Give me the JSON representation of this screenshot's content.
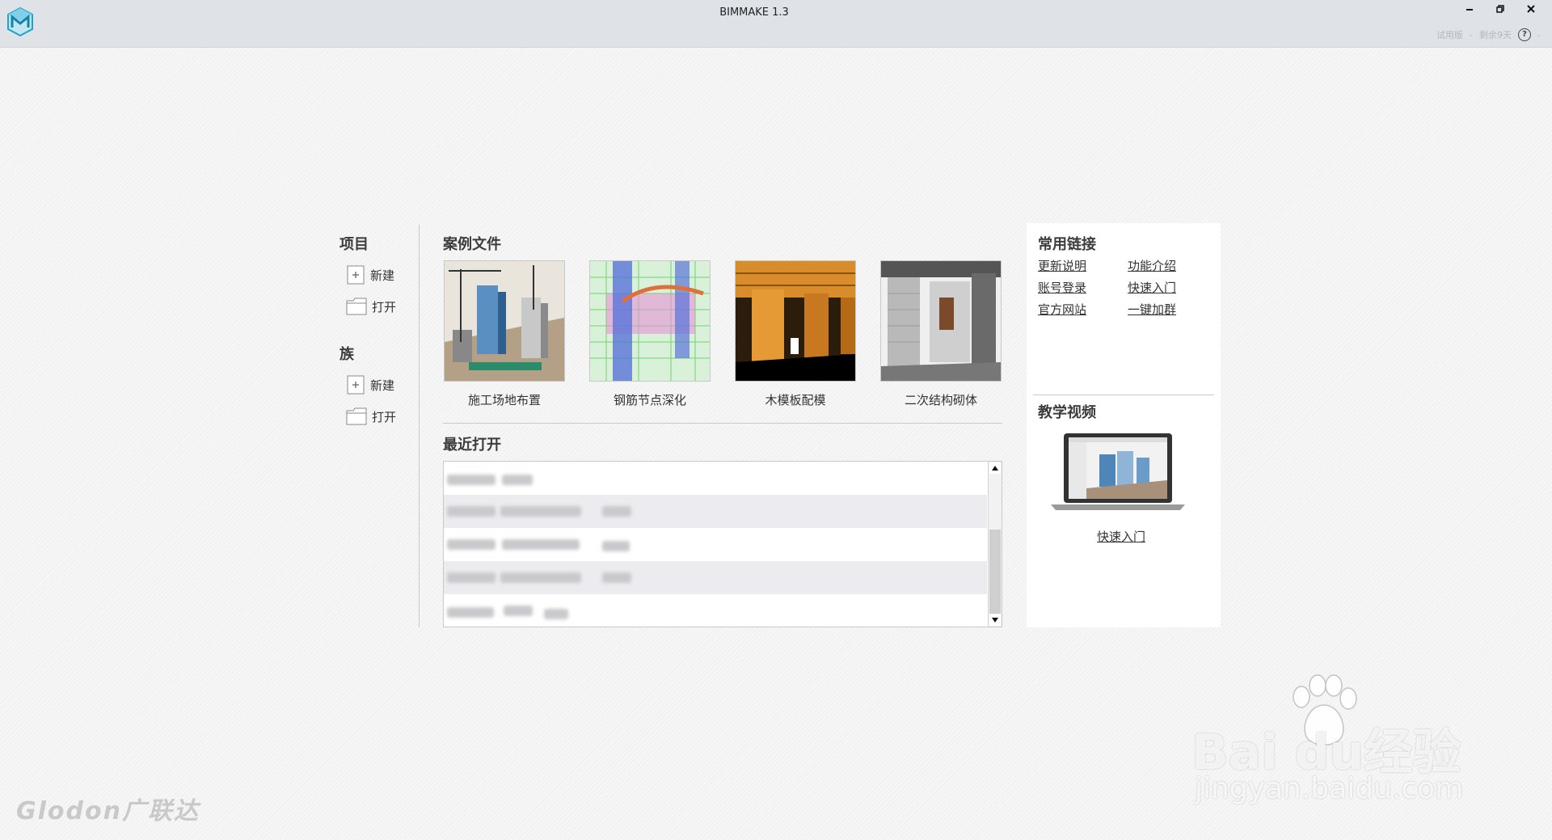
{
  "window": {
    "title": "BIMMAKE 1.3",
    "status_trial": "试用版",
    "status_remaining": "剩余9天",
    "help_symbol": "?"
  },
  "sidebar": {
    "project_title": "项目",
    "project_new": "新建",
    "project_open": "打开",
    "family_title": "族",
    "family_new": "新建",
    "family_open": "打开"
  },
  "cases": {
    "title": "案例文件",
    "items": [
      {
        "label": "施工场地布置"
      },
      {
        "label": "钢筋节点深化"
      },
      {
        "label": "木模板配模"
      },
      {
        "label": "二次结构砌体"
      }
    ]
  },
  "recent": {
    "title": "最近打开"
  },
  "links": {
    "title": "常用链接",
    "items": [
      "更新说明",
      "功能介绍",
      "账号登录",
      "快速入门",
      "官方网站",
      "一键加群"
    ]
  },
  "video": {
    "title": "教学视频",
    "link": "快速入门"
  },
  "footer": {
    "brand": "Glodon广联达"
  },
  "watermark": {
    "main": "Bai du经验",
    "sub": "jingyan.baidu.com"
  },
  "colors": {
    "accent": "#1fa3c9",
    "text": "#333333",
    "titlebar": "#dfe3e8"
  }
}
